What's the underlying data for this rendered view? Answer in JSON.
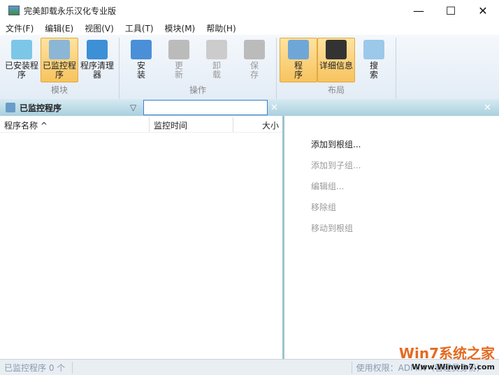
{
  "window": {
    "title": "完美卸载永乐汉化专业版",
    "min": "—",
    "max": "☐",
    "close": "✕"
  },
  "menu": [
    "文件(F)",
    "编辑(E)",
    "视图(V)",
    "工具(T)",
    "模块(M)",
    "帮助(H)"
  ],
  "ribbon": {
    "groups": [
      {
        "label": "模块",
        "buttons": [
          {
            "label": "已安装程序",
            "color": "#7cc6e8"
          },
          {
            "label": "已监控程序",
            "color": "#8bb6d6",
            "active": true
          },
          {
            "label": "程序清理器",
            "color": "#3d8fd6"
          }
        ]
      },
      {
        "label": "操作",
        "buttons": [
          {
            "label": "安装",
            "color": "#4a8fd8"
          },
          {
            "label": "更新",
            "color": "#bbb",
            "disabled": true
          },
          {
            "label": "卸载",
            "color": "#ccc",
            "disabled": true
          },
          {
            "label": "保存",
            "color": "#bbb",
            "disabled": true
          }
        ]
      },
      {
        "label": "布局",
        "buttons": [
          {
            "label": "程序",
            "color": "#6fa6d8",
            "active": true
          },
          {
            "label": "详细信息",
            "color": "#333",
            "active": true
          },
          {
            "label": "搜索",
            "color": "#9cc8ea"
          }
        ]
      }
    ]
  },
  "panel": {
    "title": "已监控程序",
    "filter_value": ""
  },
  "columns": [
    "程序名称 ^",
    "监控时间",
    "大小"
  ],
  "actions": [
    {
      "label": "添加到根组...",
      "enabled": true
    },
    {
      "label": "添加到子组...",
      "enabled": false
    },
    {
      "label": "编辑组...",
      "enabled": false
    },
    {
      "label": "移除组",
      "enabled": false
    },
    {
      "label": "移动到根组",
      "enabled": false
    }
  ],
  "status": {
    "left": "已监控程序 0 个",
    "right": "使用权限：ADMIN（管理员身份）"
  },
  "watermark": {
    "brand": "Win7系统之家",
    "url": "Www.Winwin7.com"
  }
}
